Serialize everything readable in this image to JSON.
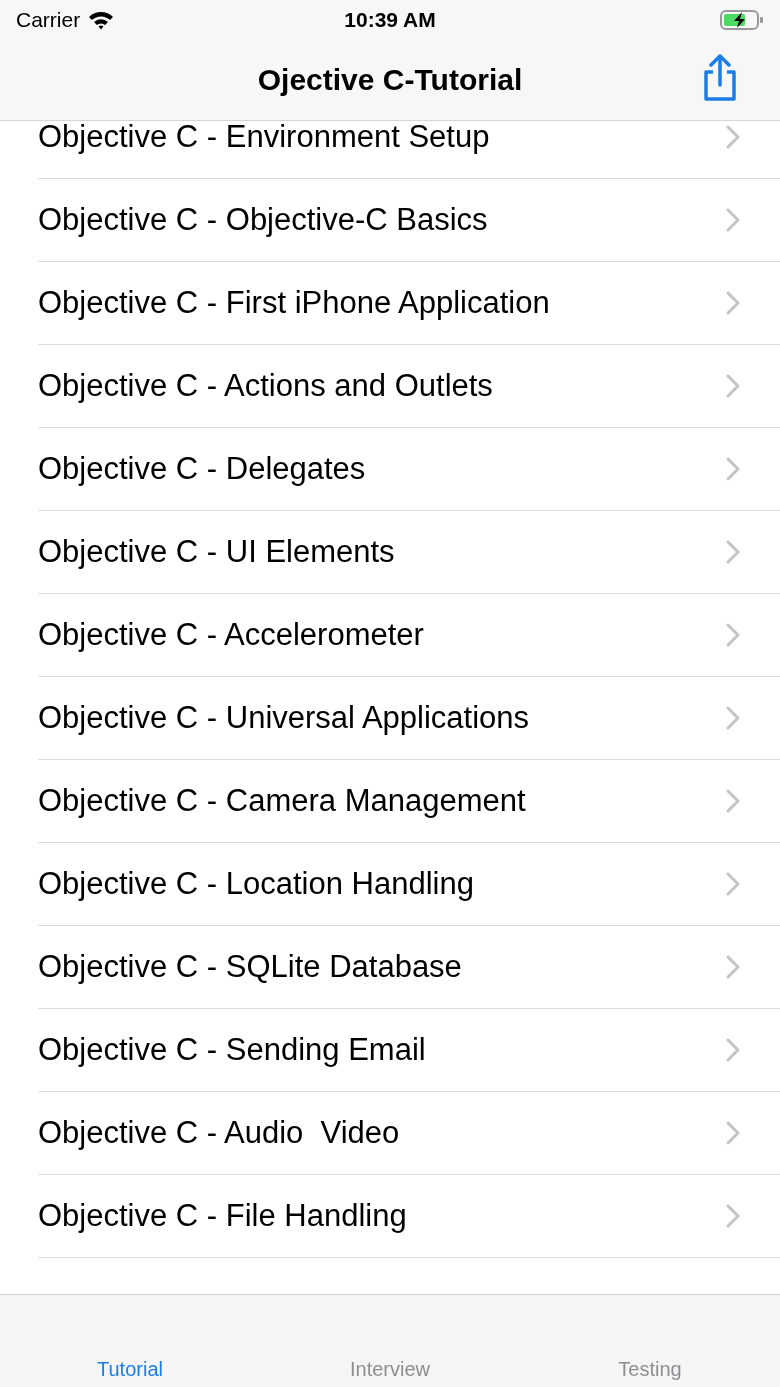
{
  "status_bar": {
    "carrier": "Carrier",
    "time": "10:39 AM",
    "charging": true
  },
  "nav_bar": {
    "title": "Ojective C-Tutorial"
  },
  "list": [
    {
      "title": "Objective C - Environment Setup"
    },
    {
      "title": "Objective C - Objective-C Basics"
    },
    {
      "title": "Objective C - First iPhone Application"
    },
    {
      "title": "Objective C - Actions and Outlets"
    },
    {
      "title": "Objective C - Delegates"
    },
    {
      "title": "Objective C - UI Elements"
    },
    {
      "title": "Objective C - Accelerometer"
    },
    {
      "title": "Objective C - Universal Applications"
    },
    {
      "title": "Objective C - Camera Management"
    },
    {
      "title": "Objective C - Location Handling"
    },
    {
      "title": "Objective C - SQLite Database"
    },
    {
      "title": "Objective C - Sending Email"
    },
    {
      "title": "Objective C - Audio  Video"
    },
    {
      "title": "Objective C - File Handling"
    }
  ],
  "tabs": [
    {
      "label": "Tutorial",
      "selected": true
    },
    {
      "label": "Interview",
      "selected": false
    },
    {
      "label": "Testing",
      "selected": false
    }
  ]
}
